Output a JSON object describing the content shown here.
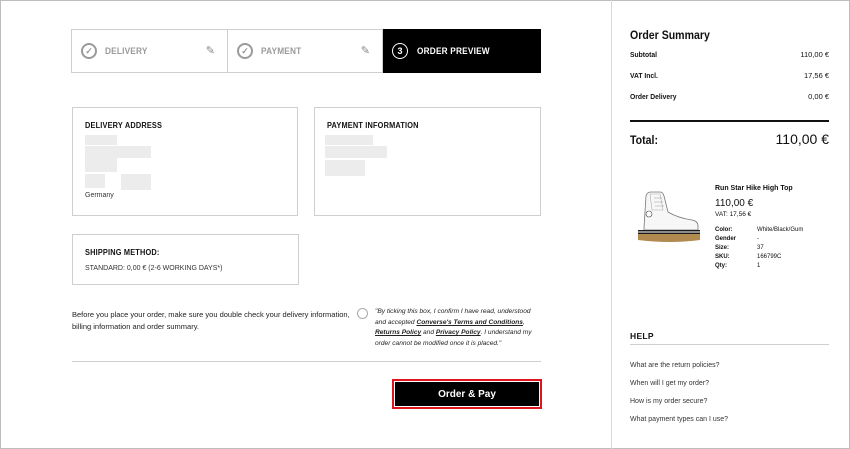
{
  "steps": [
    {
      "label": "DELIVERY",
      "state": "done",
      "icon": "check-icon"
    },
    {
      "label": "PAYMENT",
      "state": "done",
      "icon": "check-icon"
    },
    {
      "label": "ORDER PREVIEW",
      "state": "active",
      "number": "3"
    }
  ],
  "delivery_address": {
    "title": "DELIVERY ADDRESS",
    "country": "Germany"
  },
  "payment_information": {
    "title": "PAYMENT INFORMATION"
  },
  "shipping": {
    "title": "SHIPPING METHOD:",
    "value": "STANDARD: 0,00 € (2-6 WORKING DAYS*)"
  },
  "notice": "Before you place your order, make sure you double check your delivery information, billing information and order summary.",
  "terms": {
    "part1": "\"By ticking this box, I confirm I have read, understood and accepted ",
    "link1": "Converse's Terms and Conditions",
    "sep": ", ",
    "link2": "Returns Policy",
    "and": " and ",
    "link3": "Privacy Policy",
    "part2": ". I understand my order cannot be modified once it is placed.\""
  },
  "order_button": "Order & Pay",
  "summary": {
    "title": "Order Summary",
    "rows": [
      {
        "label": "Subtotal",
        "value": "110,00 €"
      },
      {
        "label": "VAT Incl.",
        "value": "17,56 €"
      },
      {
        "label": "Order Delivery",
        "value": "0,00 €"
      }
    ],
    "total_label": "Total:",
    "total_value": "110,00 €"
  },
  "product": {
    "name": "Run Star Hike High Top",
    "price": "110,00 €",
    "vat": "VAT: 17,56 €",
    "attributes": [
      {
        "label": "Color:",
        "value": "White/Black/Gum"
      },
      {
        "label": "Gender",
        "value": "-"
      },
      {
        "label": "Size:",
        "value": "37"
      },
      {
        "label": "SKU:",
        "value": "166799C"
      },
      {
        "label": "Qty:",
        "value": "1"
      }
    ]
  },
  "help": {
    "title": "HELP",
    "links": [
      "What are the return policies?",
      "When will I get my order?",
      "How is my order secure?",
      "What payment types can I use?"
    ]
  }
}
